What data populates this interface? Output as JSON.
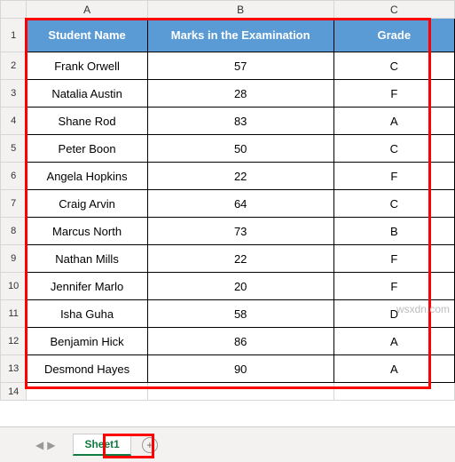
{
  "columns": [
    "A",
    "B",
    "C"
  ],
  "headers": {
    "name": "Student Name",
    "marks": "Marks in the Examination",
    "grade": "Grade"
  },
  "rows": [
    {
      "rownum": "2",
      "name": "Frank Orwell",
      "marks": "57",
      "grade": "C"
    },
    {
      "rownum": "3",
      "name": "Natalia Austin",
      "marks": "28",
      "grade": "F"
    },
    {
      "rownum": "4",
      "name": "Shane Rod",
      "marks": "83",
      "grade": "A"
    },
    {
      "rownum": "5",
      "name": "Peter Boon",
      "marks": "50",
      "grade": "C"
    },
    {
      "rownum": "6",
      "name": "Angela Hopkins",
      "marks": "22",
      "grade": "F"
    },
    {
      "rownum": "7",
      "name": "Craig Arvin",
      "marks": "64",
      "grade": "C"
    },
    {
      "rownum": "8",
      "name": "Marcus North",
      "marks": "73",
      "grade": "B"
    },
    {
      "rownum": "9",
      "name": "Nathan Mills",
      "marks": "22",
      "grade": "F"
    },
    {
      "rownum": "10",
      "name": "Jennifer Marlo",
      "marks": "20",
      "grade": "F"
    },
    {
      "rownum": "11",
      "name": "Isha Guha",
      "marks": "58",
      "grade": "D"
    },
    {
      "rownum": "12",
      "name": "Benjamin Hick",
      "marks": "86",
      "grade": "A"
    },
    {
      "rownum": "13",
      "name": "Desmond Hayes",
      "marks": "90",
      "grade": "A"
    }
  ],
  "emptyRow": "14",
  "tab": {
    "name": "Sheet1",
    "add": "+"
  },
  "nav": {
    "left": "◀",
    "right": "▶"
  },
  "watermark": "wsxdn.com"
}
